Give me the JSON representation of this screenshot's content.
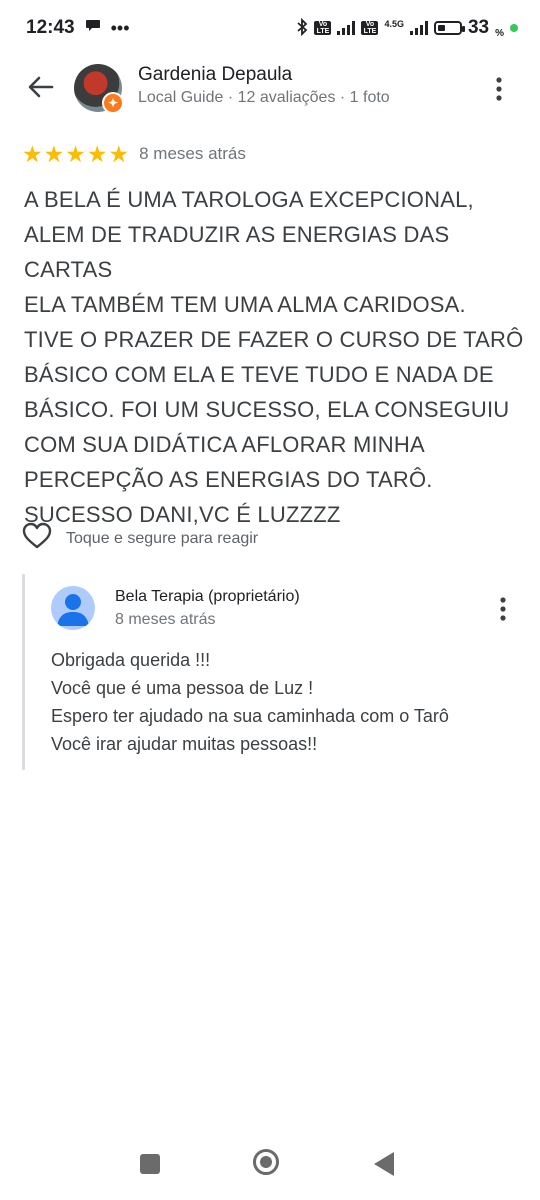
{
  "status_bar": {
    "time": "12:43",
    "network": "4.5G",
    "battery_percent": "33",
    "battery_unit": "%"
  },
  "header": {
    "back_icon": "arrow-left-icon",
    "reviewer_name": "Gardenia Depaula",
    "reviewer_meta": "Local Guide · 12 avaliações · 1 foto",
    "more_icon": "more-vert-icon"
  },
  "review": {
    "rating": 5,
    "rating_max": 5,
    "star_color": "#fbbc04",
    "time": "8 meses atrás",
    "text": "A BELA É UMA TAROLOGA EXCEPCIONAL,\nALEM DE TRADUZIR AS ENERGIAS DAS CARTAS\nELA TAMBÉM TEM UMA ALMA CARIDOSA.\nTIVE O PRAZER DE FAZER O CURSO DE TARÔ\nBÁSICO COM ELA E TEVE TUDO E NADA DE\nBÁSICO. FOI UM SUCESSO, ELA CONSEGUIU\nCOM SUA DIDÁTICA AFLORAR MINHA\nPERCEPÇÃO AS ENERGIAS DO TARÔ.\nSUCESSO DANI,VC É LUZZZZ"
  },
  "reaction": {
    "icon": "heart-outline-icon",
    "label": "Toque e segure para reagir"
  },
  "owner_reply": {
    "name": "Bela Terapia (proprietário)",
    "time": "8 meses atrás",
    "text": "Obrigada querida !!!\nVocê que é uma pessoa de Luz !\nEspero ter ajudado na sua caminhada com o Tarô\nVocê irar ajudar muitas pessoas!!"
  },
  "nav_bar": {
    "recents_icon": "square-icon",
    "home_icon": "circle-home-icon",
    "back_icon": "triangle-back-icon"
  }
}
